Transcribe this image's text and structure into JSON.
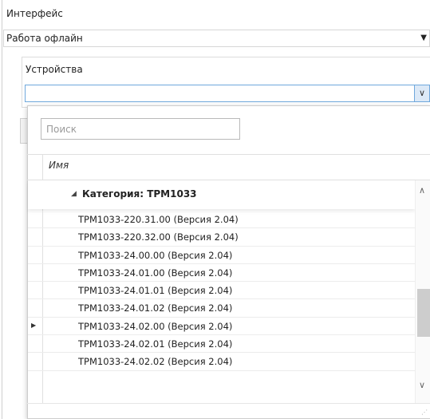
{
  "interface": {
    "label": "Интерфейс",
    "selected": "Работа офлайн"
  },
  "devices": {
    "label": "Устройства",
    "value": ""
  },
  "dropdown": {
    "search_placeholder": "Поиск",
    "column_name": "Имя",
    "group_label": "Категория: ТРМ1033",
    "items": [
      "ТРМ1033-220.31.00 (Версия 2.04)",
      "ТРМ1033-220.32.00 (Версия 2.04)",
      "ТРМ1033-24.00.00 (Версия 2.04)",
      "ТРМ1033-24.01.00 (Версия 2.04)",
      "ТРМ1033-24.01.01 (Версия 2.04)",
      "ТРМ1033-24.01.02 (Версия 2.04)",
      "ТРМ1033-24.02.00 (Версия 2.04)",
      "ТРМ1033-24.02.01 (Версия 2.04)",
      "ТРМ1033-24.02.02 (Версия 2.04)"
    ],
    "current_row_index": 6
  },
  "icons": {
    "dropdown_arrow": "chevron-down-icon",
    "group_expander": "triangle-expanded-icon",
    "row_marker": "row-pointer-icon"
  },
  "colors": {
    "focus_border": "#6fa8dc",
    "combo_button_bg": "#dce9f7"
  }
}
